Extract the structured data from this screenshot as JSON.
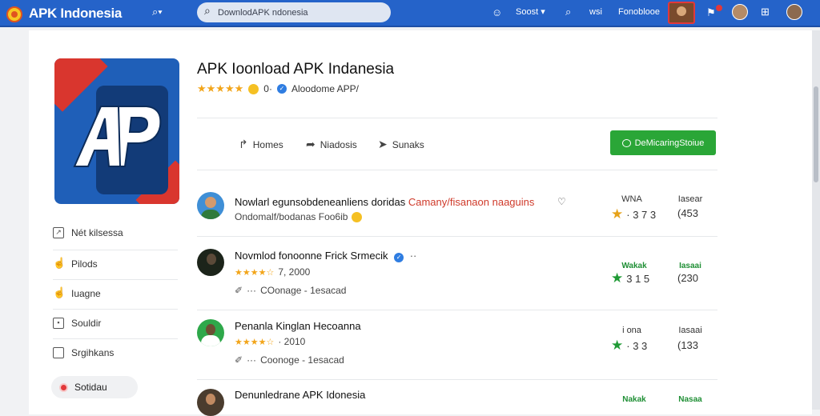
{
  "topbar": {
    "brand_prefix": "APK",
    "brand_suffix": " Indonesia",
    "search_placeholder": "DownlodAPK ndonesia",
    "user_label": "Soost",
    "link1": "wsi",
    "link2": "Fonoblooe"
  },
  "app": {
    "title": "APK Ioonload APK Indanesia",
    "rating_count": "0·",
    "publisher": "Aloodome APP/"
  },
  "actions": [
    {
      "label": "Homes",
      "icon": "share-icon"
    },
    {
      "label": "Niadosis",
      "icon": "arrow-icon"
    },
    {
      "label": "Sunaks",
      "icon": "send-icon"
    }
  ],
  "download_button": {
    "label": "DeMicaringStoiue"
  },
  "sidebar": {
    "items": [
      {
        "label": "Nét kilsessa",
        "icon": "calendar-icon"
      },
      {
        "label": "Pilods",
        "icon": "thumbs-up-icon"
      },
      {
        "label": "Iuagne",
        "icon": "thumbs-up-icon"
      },
      {
        "label": "Souldir",
        "icon": "square-icon"
      },
      {
        "label": "Srgihkans",
        "icon": "folder-icon"
      }
    ],
    "active": {
      "label": "Sotidau",
      "icon": "pin-icon"
    }
  },
  "list": [
    {
      "title": "Nowlarl egunsobdeneanliens",
      "title_tail_plain": " doridas ",
      "title_tail_accent": "Camany/fisanaon naaguins",
      "sub": "Ondomalf/bodanas Foo6ib",
      "meta_top": "WNA",
      "meta_value": "· 3 7 3",
      "right_top": "Iasear",
      "right_value": "(453"
    },
    {
      "title": "Novmlod fonoonne Frick Srmecik",
      "rating_text": "7, 2000",
      "tag": "COonage - 1esacad",
      "meta_top": "Wakak",
      "meta_value": "3 1 5",
      "right_top": "Iasaai",
      "right_value": "(230"
    },
    {
      "title": "Penanla Kinglan Hecoanna",
      "rating_text": "· 2010",
      "tag": "Coonoge - 1esacad",
      "meta_top": "i ona",
      "meta_value": "· 3 3",
      "right_top": "Iasaai",
      "right_value": "(133"
    },
    {
      "title": "Denunledrane APK Idonesia",
      "meta_top": "Nakak",
      "right_top": "Nasaa"
    }
  ],
  "colors": {
    "topbar": "#2563c9",
    "download_button": "#2aa637",
    "star": "#f2a51a",
    "accent_red": "#cf3a2a",
    "green": "#1f9a35"
  }
}
